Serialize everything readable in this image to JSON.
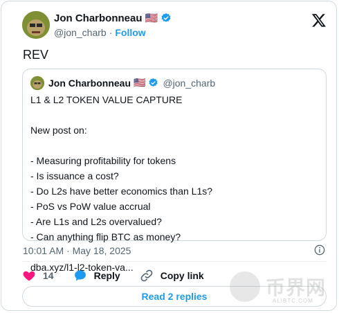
{
  "author": {
    "name": "Jon Charbonneau",
    "flag": "🇺🇸",
    "handle": "@jon_charb",
    "separator": "·",
    "follow_label": "Follow"
  },
  "tweet": {
    "text": "REV",
    "timestamp": "10:01 AM · May 18, 2025"
  },
  "quoted": {
    "name": "Jon Charbonneau",
    "flag": "🇺🇸",
    "handle": "@jon_charb",
    "lines": [
      "L1 & L2 TOKEN VALUE CAPTURE",
      "",
      "New post on:",
      "",
      "- Measuring profitability for tokens",
      "- Is issuance a cost?",
      "- Do L2s have better economics than L1s?",
      "- PoS vs PoW value accrual",
      "- Are L1s and L2s overvalued?",
      "- Can anything flip BTC as money?",
      "",
      "dba.xyz/l1-l2-token-va..."
    ]
  },
  "actions": {
    "like_count": "14",
    "reply_label": "Reply",
    "copy_label": "Copy link",
    "read_replies_label": "Read 2 replies"
  },
  "watermark": {
    "text": "币界网",
    "sub": "ALIBTC.COM"
  },
  "colors": {
    "accent": "#1d9bf0",
    "like": "#f91880",
    "text": "#0f1419",
    "muted": "#536471",
    "border": "#cfd9de",
    "verified": "#1d9bf0"
  },
  "icons": [
    "x-logo-icon",
    "verified-badge-icon",
    "heart-icon",
    "reply-icon",
    "link-icon",
    "info-icon"
  ]
}
